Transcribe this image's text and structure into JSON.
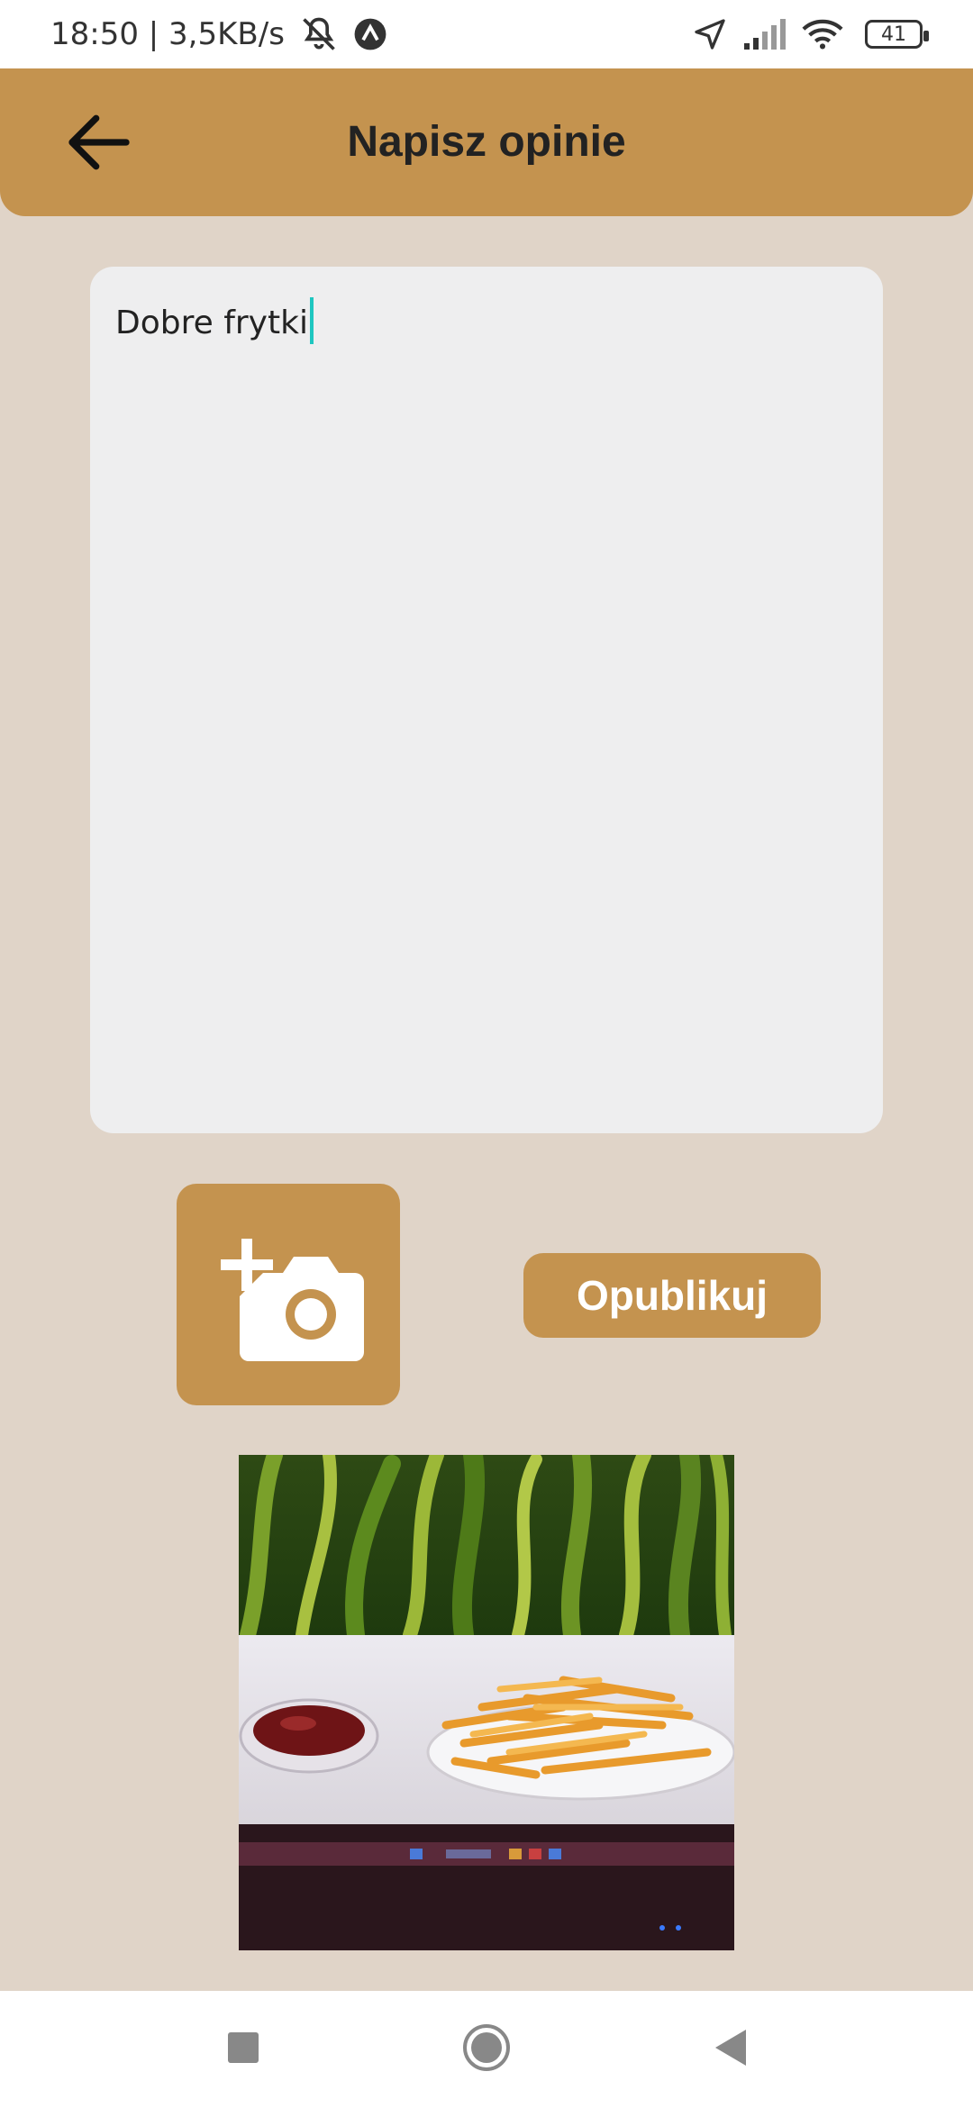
{
  "status_bar": {
    "time_speed": "18:50 | 3,5KB/s",
    "battery_level": "41",
    "icons": [
      "bell-muted-icon",
      "app-notification-icon",
      "location-arrow-icon",
      "signal-icon",
      "wifi-icon",
      "battery-icon"
    ]
  },
  "header": {
    "title": "Napisz opinie",
    "back_icon": "arrow-left-icon",
    "background": "#C4934F"
  },
  "review": {
    "text": "Dobre frytki",
    "background": "#EEEEEF",
    "caret_color": "#1EC6C0"
  },
  "actions": {
    "add_photo_icon": "add-photo-camera-icon",
    "publish_label": "Opublikuj",
    "button_color": "#C4934F"
  },
  "nav_bar": {
    "icons": [
      "recent-apps-icon",
      "home-icon",
      "back-triangle-icon"
    ]
  },
  "colors": {
    "page_background": "#E0D4C8",
    "accent": "#C4934F"
  }
}
